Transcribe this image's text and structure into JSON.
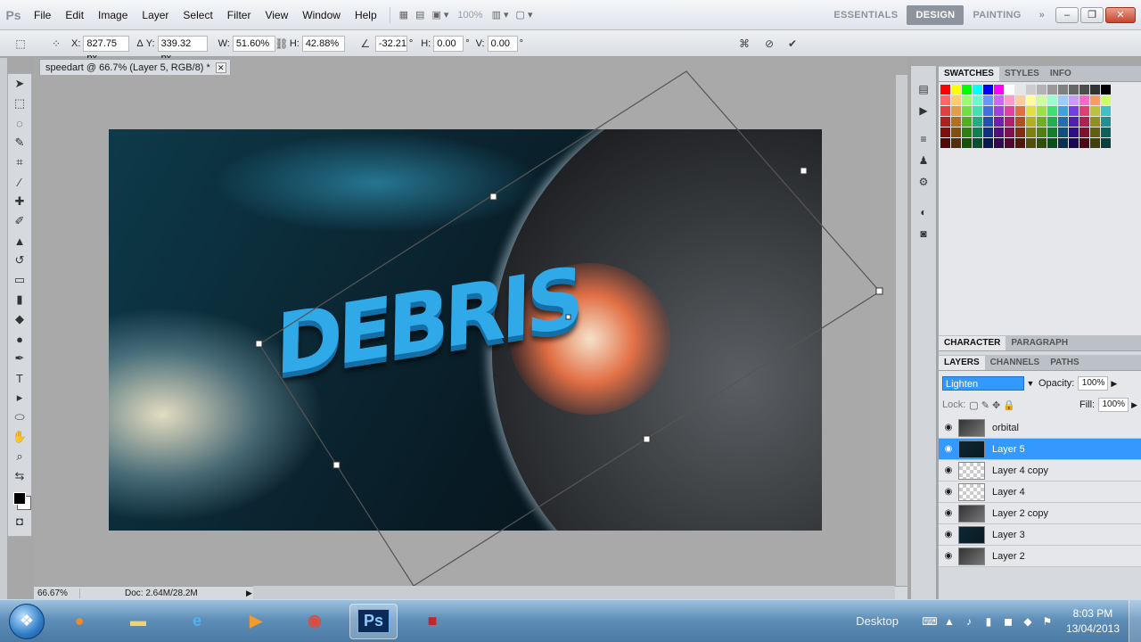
{
  "app": {
    "logo": "Ps"
  },
  "menu": [
    "File",
    "Edit",
    "Image",
    "Layer",
    "Select",
    "Filter",
    "View",
    "Window",
    "Help"
  ],
  "toolbar_zoom": "100%",
  "workspaces": [
    "ESSENTIALS",
    "DESIGN",
    "PAINTING"
  ],
  "workspaces_more": "»",
  "options": {
    "x_label": "X:",
    "x_value": "827.75 px",
    "y_label": "Y:",
    "y_value": "339.32 px",
    "w_label": "W:",
    "w_value": "51.60%",
    "h_label": "H:",
    "h_value": "42.88%",
    "angle_value": "-32.21",
    "angle_unit": "°",
    "hskew_label": "H:",
    "hskew_value": "0.00",
    "hskew_unit": "°",
    "vskew_label": "V:",
    "vskew_value": "0.00",
    "vskew_unit": "°"
  },
  "document": {
    "tab_title": "speedart @ 66.7% (Layer 5, RGB/8) *",
    "zoom_status": "66.67%",
    "doc_info": "Doc: 2.64M/28.2M",
    "artwork_text": "DEBRIS"
  },
  "panels": {
    "top_tabs": [
      "SWATCHES",
      "STYLES",
      "INFO"
    ],
    "char_tabs": [
      "CHARACTER",
      "PARAGRAPH"
    ],
    "layer_tabs": [
      "LAYERS",
      "CHANNELS",
      "PATHS"
    ],
    "blend_mode": "Lighten",
    "opacity_label": "Opacity:",
    "opacity_value": "100%",
    "lock_label": "Lock:",
    "fill_label": "Fill:",
    "fill_value": "100%",
    "layers": [
      {
        "name": "orbital",
        "selected": false,
        "thumb": "mixed"
      },
      {
        "name": "Layer 5",
        "selected": true,
        "thumb": "dark"
      },
      {
        "name": "Layer 4 copy",
        "selected": false,
        "thumb": "checker"
      },
      {
        "name": "Layer 4",
        "selected": false,
        "thumb": "checker"
      },
      {
        "name": "Layer 2 copy",
        "selected": false,
        "thumb": "mixed"
      },
      {
        "name": "Layer 3",
        "selected": false,
        "thumb": "dark"
      },
      {
        "name": "Layer 2",
        "selected": false,
        "thumb": "mixed"
      }
    ]
  },
  "swatch_colors": [
    "#ff0000",
    "#ffff00",
    "#00ff00",
    "#00ffff",
    "#0000ff",
    "#ff00ff",
    "#ffffff",
    "#e6e6e6",
    "#cccccc",
    "#b3b3b3",
    "#999999",
    "#808080",
    "#666666",
    "#4d4d4d",
    "#333333",
    "#000000",
    "#ff6666",
    "#ffcc66",
    "#99ff66",
    "#66ffcc",
    "#6699ff",
    "#cc66ff",
    "#ff99cc",
    "#ffcc99",
    "#ffff99",
    "#ccff99",
    "#99ffcc",
    "#99ccff",
    "#cc99ff",
    "#ff66cc",
    "#ff9966",
    "#ccff66",
    "#e04040",
    "#e0a040",
    "#70e040",
    "#40e0b0",
    "#4070e0",
    "#a040e0",
    "#e040a0",
    "#e07040",
    "#e0e040",
    "#a0e040",
    "#40e070",
    "#40a0e0",
    "#7040e0",
    "#e04070",
    "#c0c040",
    "#40c0c0",
    "#b02020",
    "#b07020",
    "#50b020",
    "#20b080",
    "#2050b0",
    "#7020b0",
    "#b02070",
    "#b05020",
    "#b0b020",
    "#70b020",
    "#20b050",
    "#2070b0",
    "#5020b0",
    "#b02050",
    "#909020",
    "#209090",
    "#801010",
    "#805010",
    "#308010",
    "#108050",
    "#103080",
    "#501080",
    "#801050",
    "#803010",
    "#808010",
    "#508010",
    "#108030",
    "#105080",
    "#301080",
    "#801030",
    "#606010",
    "#106060",
    "#500808",
    "#503008",
    "#185008",
    "#085030",
    "#081850",
    "#300850",
    "#500830",
    "#501808",
    "#505008",
    "#305008",
    "#085018",
    "#083050",
    "#180850",
    "#500818",
    "#404008",
    "#084040"
  ],
  "taskbar": {
    "apps": [
      "firefox",
      "explorer",
      "ie",
      "media",
      "chrome",
      "photoshop",
      "app"
    ],
    "ps_label": "Ps",
    "desktop_label": "Desktop",
    "time": "8:03 PM",
    "date": "13/04/2013"
  }
}
